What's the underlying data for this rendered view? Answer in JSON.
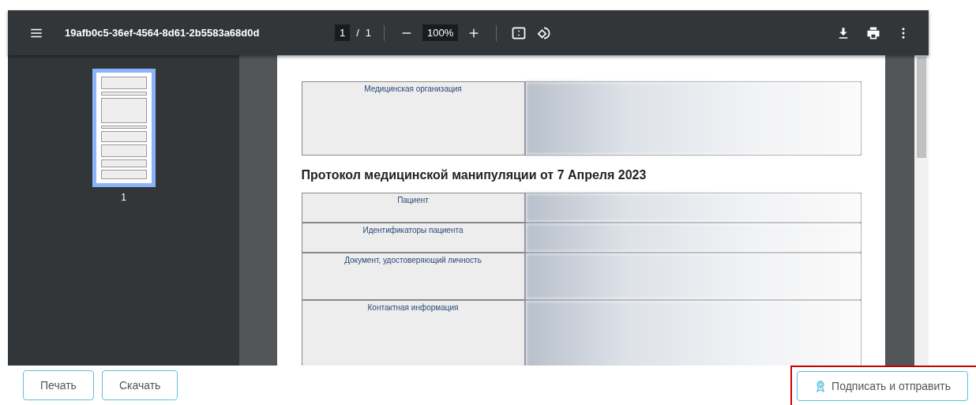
{
  "viewer": {
    "title": "19afb0c5-36ef-4564-8d61-2b5583a68d0d",
    "page_current": "1",
    "page_separator": "/",
    "page_total": "1",
    "zoom": "100%"
  },
  "thumbnails": [
    {
      "label": "1",
      "selected": true
    }
  ],
  "document": {
    "org_table": [
      {
        "label": "Медицинская организация"
      }
    ],
    "heading": "Протокол медицинской манипуляции от 7 Апреля 2023",
    "patient_table": [
      {
        "label": "Пациент"
      },
      {
        "label": "Идентификаторы пациента"
      },
      {
        "label": "Документ, удостоверяющий личность"
      },
      {
        "label": "Контактная информация"
      }
    ]
  },
  "buttons": [
    {
      "label": "Печать",
      "highlighted": false
    },
    {
      "label": "Скачать",
      "highlighted": false
    },
    {
      "label": "Подписать и отправить",
      "highlighted": true
    }
  ]
}
